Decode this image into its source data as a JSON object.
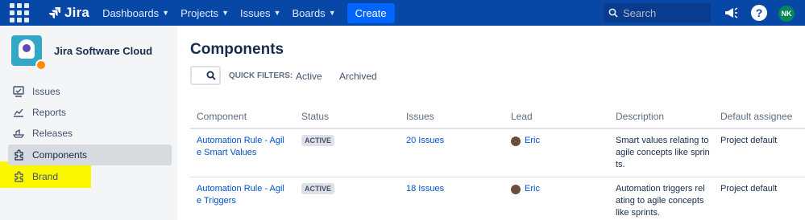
{
  "topnav": {
    "logo_text": "Jira",
    "items": [
      {
        "label": "Dashboards"
      },
      {
        "label": "Projects"
      },
      {
        "label": "Issues"
      },
      {
        "label": "Boards"
      }
    ],
    "create_label": "Create",
    "search_placeholder": "Search",
    "avatar_initials": "NK",
    "brand_color": "#0747a6"
  },
  "sidebar": {
    "project_name": "Jira Software Cloud",
    "items": [
      {
        "label": "Issues",
        "icon": "issues-icon"
      },
      {
        "label": "Reports",
        "icon": "reports-icon"
      },
      {
        "label": "Releases",
        "icon": "releases-icon"
      },
      {
        "label": "Components",
        "icon": "components-icon",
        "active": true
      },
      {
        "label": "Brand",
        "icon": "puzzle-icon",
        "highlighted": true
      }
    ]
  },
  "main": {
    "title": "Components",
    "quick_filters_label": "QUICK FILTERS:",
    "filter_active": "Active",
    "filter_archived": "Archived",
    "table": {
      "headers": [
        "Component",
        "Status",
        "Issues",
        "Lead",
        "Description",
        "Default assignee"
      ],
      "rows": [
        {
          "component_line1": "Automation Rule - Agil",
          "component_line2": "e Smart Values",
          "status": "ACTIVE",
          "issues": "20 Issues",
          "lead": "Eric",
          "description_line1": "Smart values relating to",
          "description_line2": "agile concepts like sprin",
          "description_line3": "ts.",
          "default_assignee": "Project default"
        },
        {
          "component_line1": "Automation Rule - Agil",
          "component_line2": "e Triggers",
          "status": "ACTIVE",
          "issues": "18 Issues",
          "lead": "Eric",
          "description_line1": "Automation triggers rel",
          "description_line2": "ating to agile concepts",
          "description_line3": "like sprints.",
          "default_assignee": "Project default"
        }
      ]
    }
  }
}
